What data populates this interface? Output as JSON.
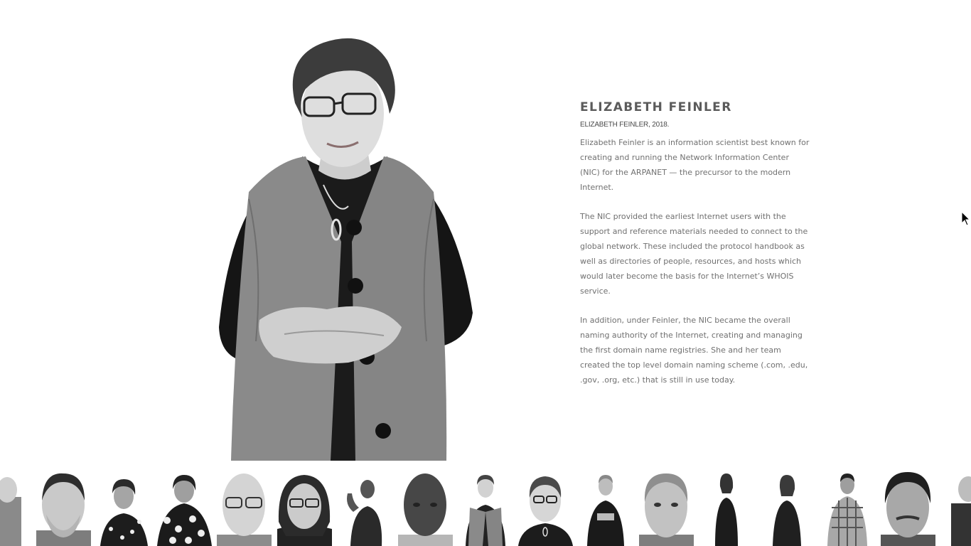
{
  "profile": {
    "name": "ELIZABETH FEINLER",
    "caption": "ELIZABETH FEINLER, 2018.",
    "paragraphs": [
      "Elizabeth Feinler is an information scientist best known for creating and running the Network Information Center (NIC) for the ARPANET — the precursor to the modern Internet.",
      "The NIC provided the earliest Internet users with the support and reference materials needed to connect to the global network. These included the protocol handbook as well as directories of people, resources, and hosts which would later become the basis for the Internet’s WHOIS service.",
      "In addition, under Feinler, the NIC became the overall naming authority of the Internet, creating and managing the first domain name registries. She and her team created the top level domain naming scheme (.com, .edu, .gov, .org, etc.) that is still in use today."
    ]
  },
  "thumbnails": {
    "count": 17,
    "selected_index": 9
  }
}
